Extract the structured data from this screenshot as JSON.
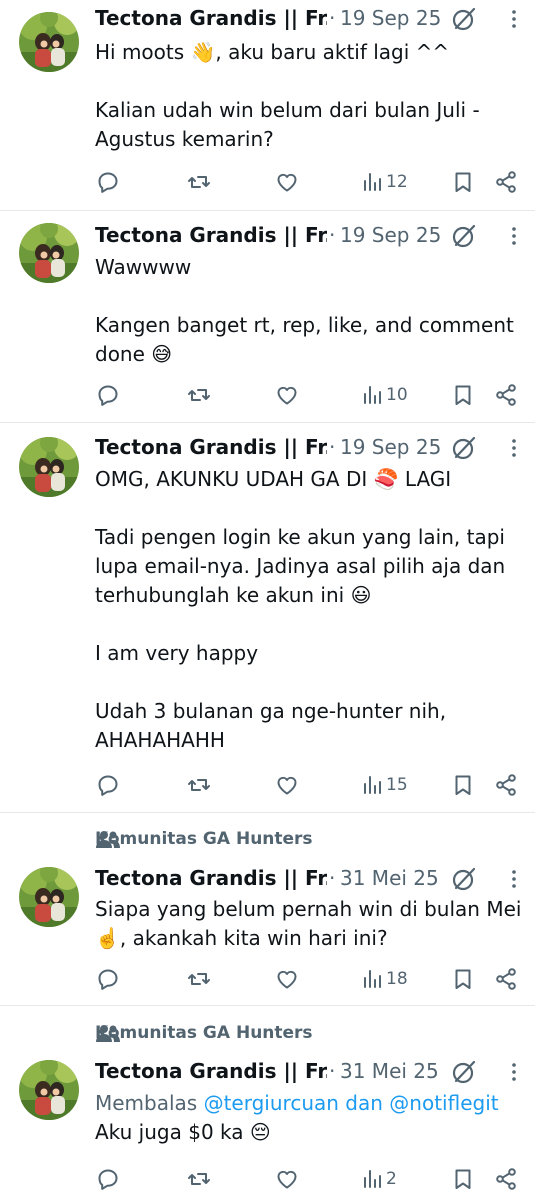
{
  "colors": {
    "text": "#0f1419",
    "muted": "#536471",
    "link": "#1d9bf0",
    "divider": "#e6e9ec"
  },
  "tweets": [
    {
      "author": "Tectona Grandis || Fr...",
      "date": "19 Sep 25",
      "lines": [
        "Hi moots 👋, aku baru aktif lagi ^^",
        "",
        "Kalian udah win belum dari bulan Juli -",
        "Agustus kemarin?"
      ],
      "views": "12"
    },
    {
      "author": "Tectona Grandis || Fr...",
      "date": "19 Sep 25",
      "lines": [
        "Wawwww",
        "",
        "Kangen banget rt, rep, like, and comment",
        "done 😅"
      ],
      "views": "10"
    },
    {
      "author": "Tectona Grandis || Fr...",
      "date": "19 Sep 25",
      "lines": [
        "OMG, AKUNKU UDAH GA DI 🍣 LAGI",
        "",
        "Tadi pengen login ke akun yang lain, tapi",
        "lupa email-nya. Jadinya asal pilih aja dan",
        "terhubunglah ke akun ini 😃",
        "",
        "I am very happy",
        "",
        "Udah 3 bulanan ga nge-hunter nih,",
        "AHAHAHAHH"
      ],
      "views": "15"
    },
    {
      "community": "Komunitas GA Hunters",
      "author": "Tectona Grandis || Fr...",
      "date": "31 Mei 25",
      "lines": [
        "Siapa yang belum pernah win di bulan Mei",
        "☝️, akankah kita win hari ini?"
      ],
      "views": "18"
    },
    {
      "community": "Komunitas GA Hunters",
      "author": "Tectona Grandis || Fr...",
      "date": "31 Mei 25",
      "replying": {
        "prefix": "Membalas",
        "user1": "@tergiurcuan",
        "joiner": "dan",
        "user2": "@notiflegit"
      },
      "lines": [
        "Aku juga $0 ka 😔"
      ],
      "views": "2"
    }
  ]
}
